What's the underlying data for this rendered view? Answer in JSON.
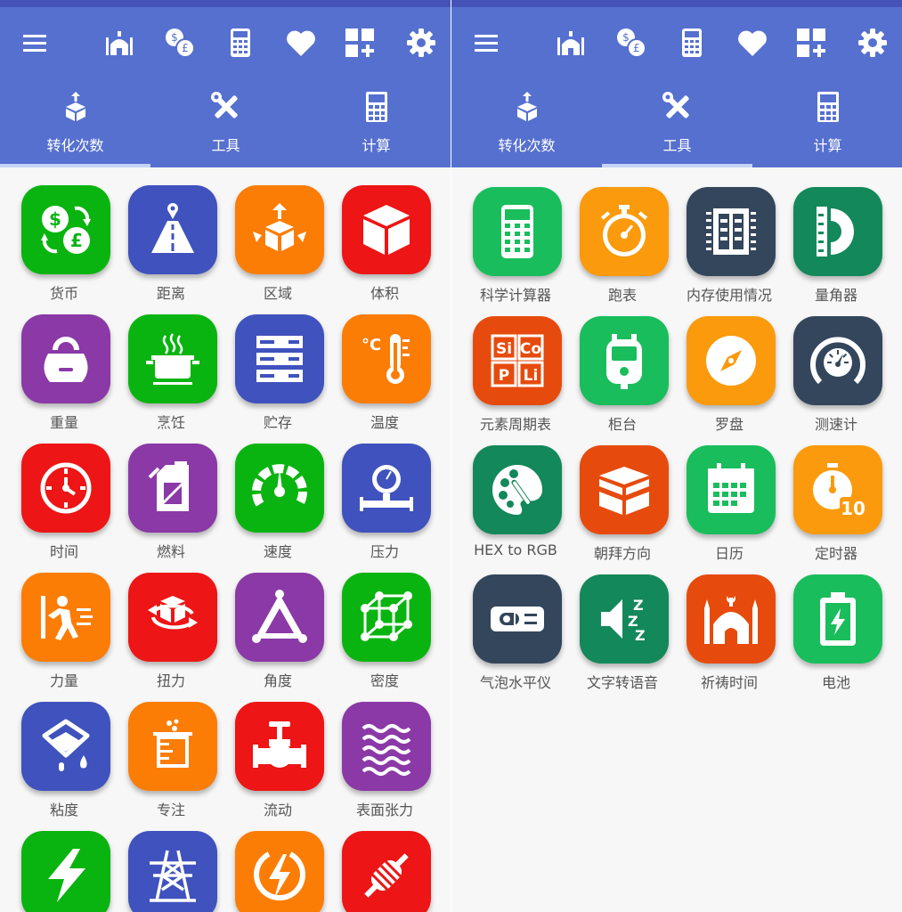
{
  "colors": {
    "toolbar": "#5670cf",
    "statusbar": "#4553b8",
    "green": "#0ab410",
    "blue": "#3f52bd",
    "orange": "#fb7d06",
    "red": "#ed1515",
    "purple": "#8a39a6",
    "dark_green": "#13885a",
    "light_green": "#19bd5c",
    "amber": "#fb9a0c",
    "navy": "#33465c",
    "deep_orange": "#e64b0d"
  },
  "toolbar_icons": [
    "menu-icon",
    "mosque-icon",
    "currency-exchange-icon",
    "calculator-icon",
    "heart-icon",
    "add-widget-icon",
    "gear-icon"
  ],
  "tabs": [
    {
      "label": "转化次数",
      "icon": "convert-icon"
    },
    {
      "label": "工具",
      "icon": "tools-icon"
    },
    {
      "label": "计算",
      "icon": "calculator-icon"
    }
  ],
  "left": {
    "active_tab": 0,
    "items": [
      {
        "label": "货币",
        "color": "green",
        "icon": "currency-icon"
      },
      {
        "label": "距离",
        "color": "blue",
        "icon": "road-icon"
      },
      {
        "label": "区域",
        "color": "orange",
        "icon": "area-icon"
      },
      {
        "label": "体积",
        "color": "red",
        "icon": "cube-icon"
      },
      {
        "label": "重量",
        "color": "purple",
        "icon": "kettlebell-icon"
      },
      {
        "label": "烹饪",
        "color": "green",
        "icon": "cooking-pot-icon"
      },
      {
        "label": "贮存",
        "color": "blue",
        "icon": "storage-icon"
      },
      {
        "label": "温度",
        "color": "orange",
        "icon": "thermometer-icon"
      },
      {
        "label": "时间",
        "color": "red",
        "icon": "clock-icon"
      },
      {
        "label": "燃料",
        "color": "purple",
        "icon": "fuel-can-icon"
      },
      {
        "label": "速度",
        "color": "green",
        "icon": "speedometer-icon"
      },
      {
        "label": "压力",
        "color": "blue",
        "icon": "pressure-gauge-icon"
      },
      {
        "label": "力量",
        "color": "orange",
        "icon": "force-icon"
      },
      {
        "label": "扭力",
        "color": "red",
        "icon": "torque-icon"
      },
      {
        "label": "角度",
        "color": "purple",
        "icon": "triangle-angle-icon"
      },
      {
        "label": "密度",
        "color": "green",
        "icon": "density-cube-icon"
      },
      {
        "label": "粘度",
        "color": "blue",
        "icon": "viscosity-bucket-icon"
      },
      {
        "label": "专注",
        "color": "orange",
        "icon": "beaker-icon"
      },
      {
        "label": "流动",
        "color": "red",
        "icon": "valve-icon"
      },
      {
        "label": "表面张力",
        "color": "purple",
        "icon": "waves-icon"
      },
      {
        "label": "",
        "color": "green",
        "icon": "lightning-icon"
      },
      {
        "label": "",
        "color": "blue",
        "icon": "power-tower-icon"
      },
      {
        "label": "",
        "color": "orange",
        "icon": "power-circle-icon"
      },
      {
        "label": "",
        "color": "red",
        "icon": "resistor-icon"
      }
    ]
  },
  "right": {
    "active_tab": 1,
    "items": [
      {
        "label": "科学计算器",
        "color": "light_green",
        "icon": "scientific-calculator-icon"
      },
      {
        "label": "跑表",
        "color": "amber",
        "icon": "stopwatch-icon"
      },
      {
        "label": "内存使用情况",
        "color": "navy",
        "icon": "memory-chip-icon"
      },
      {
        "label": "量角器",
        "color": "dark_green",
        "icon": "protractor-icon"
      },
      {
        "label": "元素周期表",
        "color": "deep_orange",
        "icon": "periodic-table-icon",
        "glyph_text": [
          "Si",
          "Co",
          "P",
          "Li"
        ]
      },
      {
        "label": "柜台",
        "color": "light_green",
        "icon": "counter-icon"
      },
      {
        "label": "罗盘",
        "color": "amber",
        "icon": "compass-icon"
      },
      {
        "label": "测速计",
        "color": "navy",
        "icon": "speedometer-icon"
      },
      {
        "label": "HEX to RGB",
        "color": "dark_green",
        "icon": "palette-icon"
      },
      {
        "label": "朝拜方向",
        "color": "deep_orange",
        "icon": "kaaba-icon"
      },
      {
        "label": "日历",
        "color": "light_green",
        "icon": "calendar-icon"
      },
      {
        "label": "定时器",
        "color": "amber",
        "icon": "timer-icon",
        "glyph_text": [
          "10"
        ]
      },
      {
        "label": "气泡水平仪",
        "color": "navy",
        "icon": "bubble-level-icon"
      },
      {
        "label": "文字转语音",
        "color": "dark_green",
        "icon": "speaker-icon",
        "glyph_text": [
          "Z",
          "Z",
          "Z"
        ]
      },
      {
        "label": "祈祷时间",
        "color": "deep_orange",
        "icon": "mosque-icon"
      },
      {
        "label": "电池",
        "color": "light_green",
        "icon": "battery-icon"
      }
    ]
  }
}
